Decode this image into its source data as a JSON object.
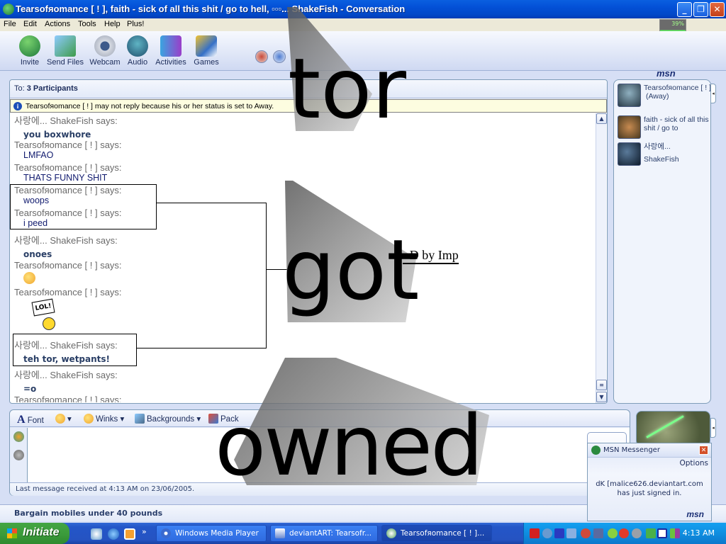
{
  "window": {
    "title": "Tearsofяomance  [ ! ], faith - sick of all this shit / go to hell, ▫▫▫... ShakeFish - Conversation",
    "controls": [
      "minimize",
      "restore",
      "close"
    ]
  },
  "menu": [
    "File",
    "Edit",
    "Actions",
    "Tools",
    "Help",
    "Plus!"
  ],
  "battery_indicator": "39%",
  "toolbar": {
    "buttons": [
      {
        "label": "Invite",
        "icon": "invite-icon"
      },
      {
        "label": "Send Files",
        "icon": "send-files-icon"
      },
      {
        "label": "Webcam",
        "icon": "webcam-icon"
      },
      {
        "label": "Audio",
        "icon": "audio-icon"
      },
      {
        "label": "Activities",
        "icon": "activities-icon"
      },
      {
        "label": "Games",
        "icon": "games-icon"
      }
    ],
    "block_icon": "block-icon",
    "display_picture_icon": "paint-icon",
    "brand": "msn"
  },
  "conversation": {
    "to_label": "To:",
    "to_value": "3 Participants",
    "info_message": "Tearsofяomance  [ ! ] may not reply because his or her status is set to Away.",
    "messages": [
      {
        "sender": "사랑에... ShakeFish says:",
        "text": "you boxwhore",
        "style": "bold"
      },
      {
        "sender": "Tearsofяomance  [ ! ] says:",
        "text": "LMFAO",
        "style": "normal"
      },
      {
        "sender": "Tearsofяomance  [ ! ] says:",
        "text": "THATS FUNNY SHIT",
        "style": "normal"
      },
      {
        "sender": "Tearsofяomance  [ ! ] says:",
        "text": "woops",
        "style": "normal"
      },
      {
        "sender": "Tearsofяomance  [ ! ] says:",
        "text": "i peed",
        "style": "normal"
      },
      {
        "sender": "사랑에... ShakeFish says:",
        "text": "onoes",
        "style": "bold"
      },
      {
        "sender": "Tearsofяomance  [ ! ] says:",
        "text": "",
        "emoticon": "rolling-eyes-emoticon"
      },
      {
        "sender": "Tearsofяomance  [ ! ] says:",
        "text": "",
        "emoticon": "lol-sign-emoticon",
        "emoticon_text": "LOL!"
      },
      {
        "sender": "사랑에... ShakeFish says:",
        "text": "teh tor, wetpants!",
        "style": "bold"
      },
      {
        "sender": "사랑에... ShakeFish says:",
        "text": "=o",
        "style": "bold"
      },
      {
        "sender": "Tearsofяomance  [ ! ] says:",
        "text": "",
        "style": "normal"
      }
    ]
  },
  "participants": [
    {
      "name": "Tearsofяomance  [ ! ]",
      "status": "(Away)"
    },
    {
      "name": "faith - sick of all this shit / go to",
      "status": ""
    },
    {
      "name": "사랑에...",
      "status": "ShakeFish"
    }
  ],
  "composer": {
    "tools": [
      {
        "label": "Font",
        "icon": "font-icon"
      },
      {
        "label": "",
        "icon": "emoticon-icon",
        "dropdown": true
      },
      {
        "label": "Winks",
        "icon": "winks-icon",
        "dropdown": true
      },
      {
        "label": "Backgrounds",
        "icon": "backgrounds-icon",
        "dropdown": true
      },
      {
        "label": "Pack",
        "icon": "gift-icon"
      }
    ],
    "input_value": "",
    "status_text": "Last message received at 4:13 AM on 23/06/2005."
  },
  "ad_text": "Bargain mobiles under 40 pounds",
  "toast": {
    "title": "MSN Messenger",
    "options_label": "Options",
    "message_line1": "dK [malice626.deviantart.com",
    "message_line2": "has just signed in.",
    "brand": "msn"
  },
  "overlay": {
    "word1": "tor",
    "word2": "got",
    "word3": "owned",
    "credit": "~D by Imp"
  },
  "taskbar": {
    "start_label": "Initiate",
    "quick_launch": [
      "messenger-icon",
      "ie-icon",
      "clock-icon"
    ],
    "tasks": [
      {
        "label": "Windows Media Player",
        "active": false
      },
      {
        "label": "deviantART: Tearsofr...",
        "active": false
      },
      {
        "label": "Tearsofяomance  [ ! ]...",
        "active": true
      }
    ],
    "clock": "4:13 AM"
  }
}
